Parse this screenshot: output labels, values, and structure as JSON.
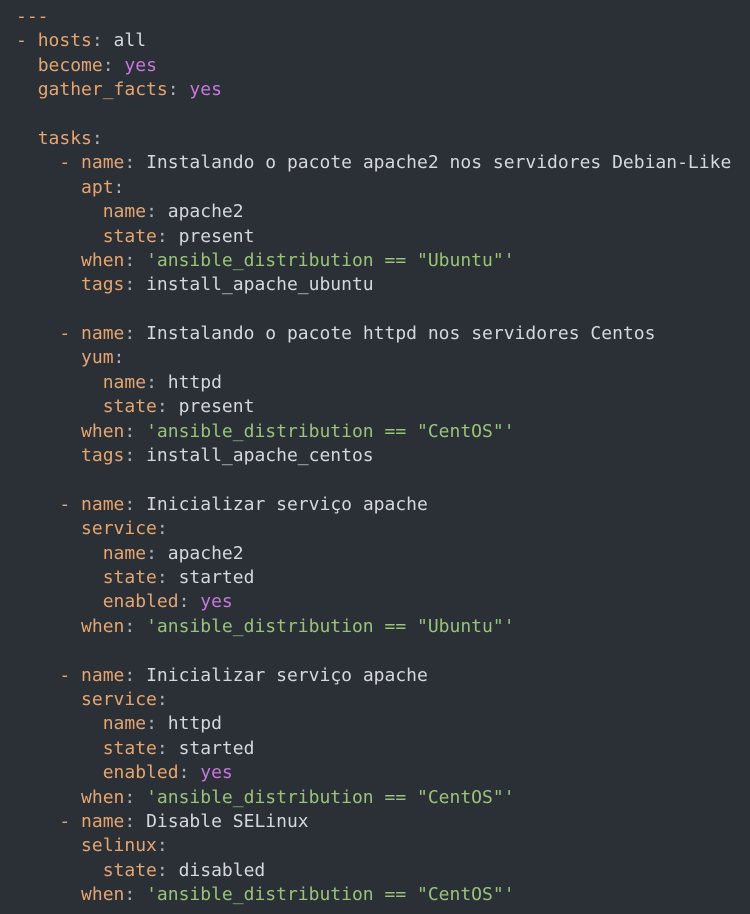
{
  "colors": {
    "background": "#2b3037",
    "key": "#e5a570",
    "value": "#d4d8de",
    "boolean": "#c678dd",
    "string": "#98c379"
  },
  "lines": [
    {
      "indent": 0,
      "dash": "---",
      "key": "",
      "colon": "",
      "value": "",
      "vtype": "v"
    },
    {
      "indent": 0,
      "dash": "- ",
      "key": "hosts",
      "colon": ":",
      "value": " all",
      "vtype": "v"
    },
    {
      "indent": 2,
      "dash": "",
      "key": "become",
      "colon": ":",
      "value": " yes",
      "vtype": "b"
    },
    {
      "indent": 2,
      "dash": "",
      "key": "gather_facts",
      "colon": ":",
      "value": " yes",
      "vtype": "b"
    },
    {
      "indent": 0,
      "dash": "",
      "key": "",
      "colon": "",
      "value": "",
      "vtype": "v"
    },
    {
      "indent": 2,
      "dash": "",
      "key": "tasks",
      "colon": ":",
      "value": "",
      "vtype": "v"
    },
    {
      "indent": 4,
      "dash": "- ",
      "key": "name",
      "colon": ":",
      "value": " Instalando o pacote apache2 nos servidores Debian-Like",
      "vtype": "v"
    },
    {
      "indent": 6,
      "dash": "",
      "key": "apt",
      "colon": ":",
      "value": "",
      "vtype": "v"
    },
    {
      "indent": 8,
      "dash": "",
      "key": "name",
      "colon": ":",
      "value": " apache2",
      "vtype": "v"
    },
    {
      "indent": 8,
      "dash": "",
      "key": "state",
      "colon": ":",
      "value": " present",
      "vtype": "v"
    },
    {
      "indent": 6,
      "dash": "",
      "key": "when",
      "colon": ":",
      "value": " 'ansible_distribution == \"Ubuntu\"'",
      "vtype": "s"
    },
    {
      "indent": 6,
      "dash": "",
      "key": "tags",
      "colon": ":",
      "value": " install_apache_ubuntu",
      "vtype": "v"
    },
    {
      "indent": 0,
      "dash": "",
      "key": "",
      "colon": "",
      "value": "",
      "vtype": "v"
    },
    {
      "indent": 4,
      "dash": "- ",
      "key": "name",
      "colon": ":",
      "value": " Instalando o pacote httpd nos servidores Centos",
      "vtype": "v"
    },
    {
      "indent": 6,
      "dash": "",
      "key": "yum",
      "colon": ":",
      "value": "",
      "vtype": "v"
    },
    {
      "indent": 8,
      "dash": "",
      "key": "name",
      "colon": ":",
      "value": " httpd",
      "vtype": "v"
    },
    {
      "indent": 8,
      "dash": "",
      "key": "state",
      "colon": ":",
      "value": " present",
      "vtype": "v"
    },
    {
      "indent": 6,
      "dash": "",
      "key": "when",
      "colon": ":",
      "value": " 'ansible_distribution == \"CentOS\"'",
      "vtype": "s"
    },
    {
      "indent": 6,
      "dash": "",
      "key": "tags",
      "colon": ":",
      "value": " install_apache_centos",
      "vtype": "v"
    },
    {
      "indent": 0,
      "dash": "",
      "key": "",
      "colon": "",
      "value": "",
      "vtype": "v"
    },
    {
      "indent": 4,
      "dash": "- ",
      "key": "name",
      "colon": ":",
      "value": " Inicializar serviço apache",
      "vtype": "v"
    },
    {
      "indent": 6,
      "dash": "",
      "key": "service",
      "colon": ":",
      "value": "",
      "vtype": "v"
    },
    {
      "indent": 8,
      "dash": "",
      "key": "name",
      "colon": ":",
      "value": " apache2",
      "vtype": "v"
    },
    {
      "indent": 8,
      "dash": "",
      "key": "state",
      "colon": ":",
      "value": " started",
      "vtype": "v"
    },
    {
      "indent": 8,
      "dash": "",
      "key": "enabled",
      "colon": ":",
      "value": " yes",
      "vtype": "b"
    },
    {
      "indent": 6,
      "dash": "",
      "key": "when",
      "colon": ":",
      "value": " 'ansible_distribution == \"Ubuntu\"'",
      "vtype": "s"
    },
    {
      "indent": 0,
      "dash": "",
      "key": "",
      "colon": "",
      "value": "",
      "vtype": "v"
    },
    {
      "indent": 4,
      "dash": "- ",
      "key": "name",
      "colon": ":",
      "value": " Inicializar serviço apache",
      "vtype": "v"
    },
    {
      "indent": 6,
      "dash": "",
      "key": "service",
      "colon": ":",
      "value": "",
      "vtype": "v"
    },
    {
      "indent": 8,
      "dash": "",
      "key": "name",
      "colon": ":",
      "value": " httpd",
      "vtype": "v"
    },
    {
      "indent": 8,
      "dash": "",
      "key": "state",
      "colon": ":",
      "value": " started",
      "vtype": "v"
    },
    {
      "indent": 8,
      "dash": "",
      "key": "enabled",
      "colon": ":",
      "value": " yes",
      "vtype": "b"
    },
    {
      "indent": 6,
      "dash": "",
      "key": "when",
      "colon": ":",
      "value": " 'ansible_distribution == \"CentOS\"'",
      "vtype": "s"
    },
    {
      "indent": 4,
      "dash": "- ",
      "key": "name",
      "colon": ":",
      "value": " Disable SELinux",
      "vtype": "v"
    },
    {
      "indent": 6,
      "dash": "",
      "key": "selinux",
      "colon": ":",
      "value": "",
      "vtype": "v"
    },
    {
      "indent": 8,
      "dash": "",
      "key": "state",
      "colon": ":",
      "value": " disabled",
      "vtype": "v"
    },
    {
      "indent": 6,
      "dash": "",
      "key": "when",
      "colon": ":",
      "value": " 'ansible_distribution == \"CentOS\"'",
      "vtype": "s"
    }
  ]
}
